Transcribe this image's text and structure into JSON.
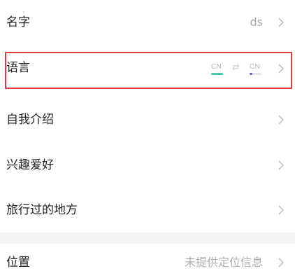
{
  "rows": {
    "name": {
      "label": "名字",
      "value": "ds"
    },
    "language": {
      "label": "语言",
      "from_code": "CN",
      "to_code": "CN",
      "swap_symbol": "⇄",
      "from_bar_color": "#4cc9a4",
      "to_bar_color": "#e6e6e6",
      "to_dot_color": "#6a5ae0"
    },
    "intro": {
      "label": "自我介绍"
    },
    "hobbies": {
      "label": "兴趣爱好"
    },
    "traveled": {
      "label": "旅行过的地方"
    },
    "location": {
      "label": "位置",
      "value": "未提供定位信息"
    }
  },
  "colors": {
    "highlight_border": "#e0393e",
    "chevron": "#c4c4c4",
    "separator": "#f4f4f4"
  },
  "icons": {
    "chevron": "chevron-right-icon",
    "swap": "swap-arrows-icon"
  }
}
